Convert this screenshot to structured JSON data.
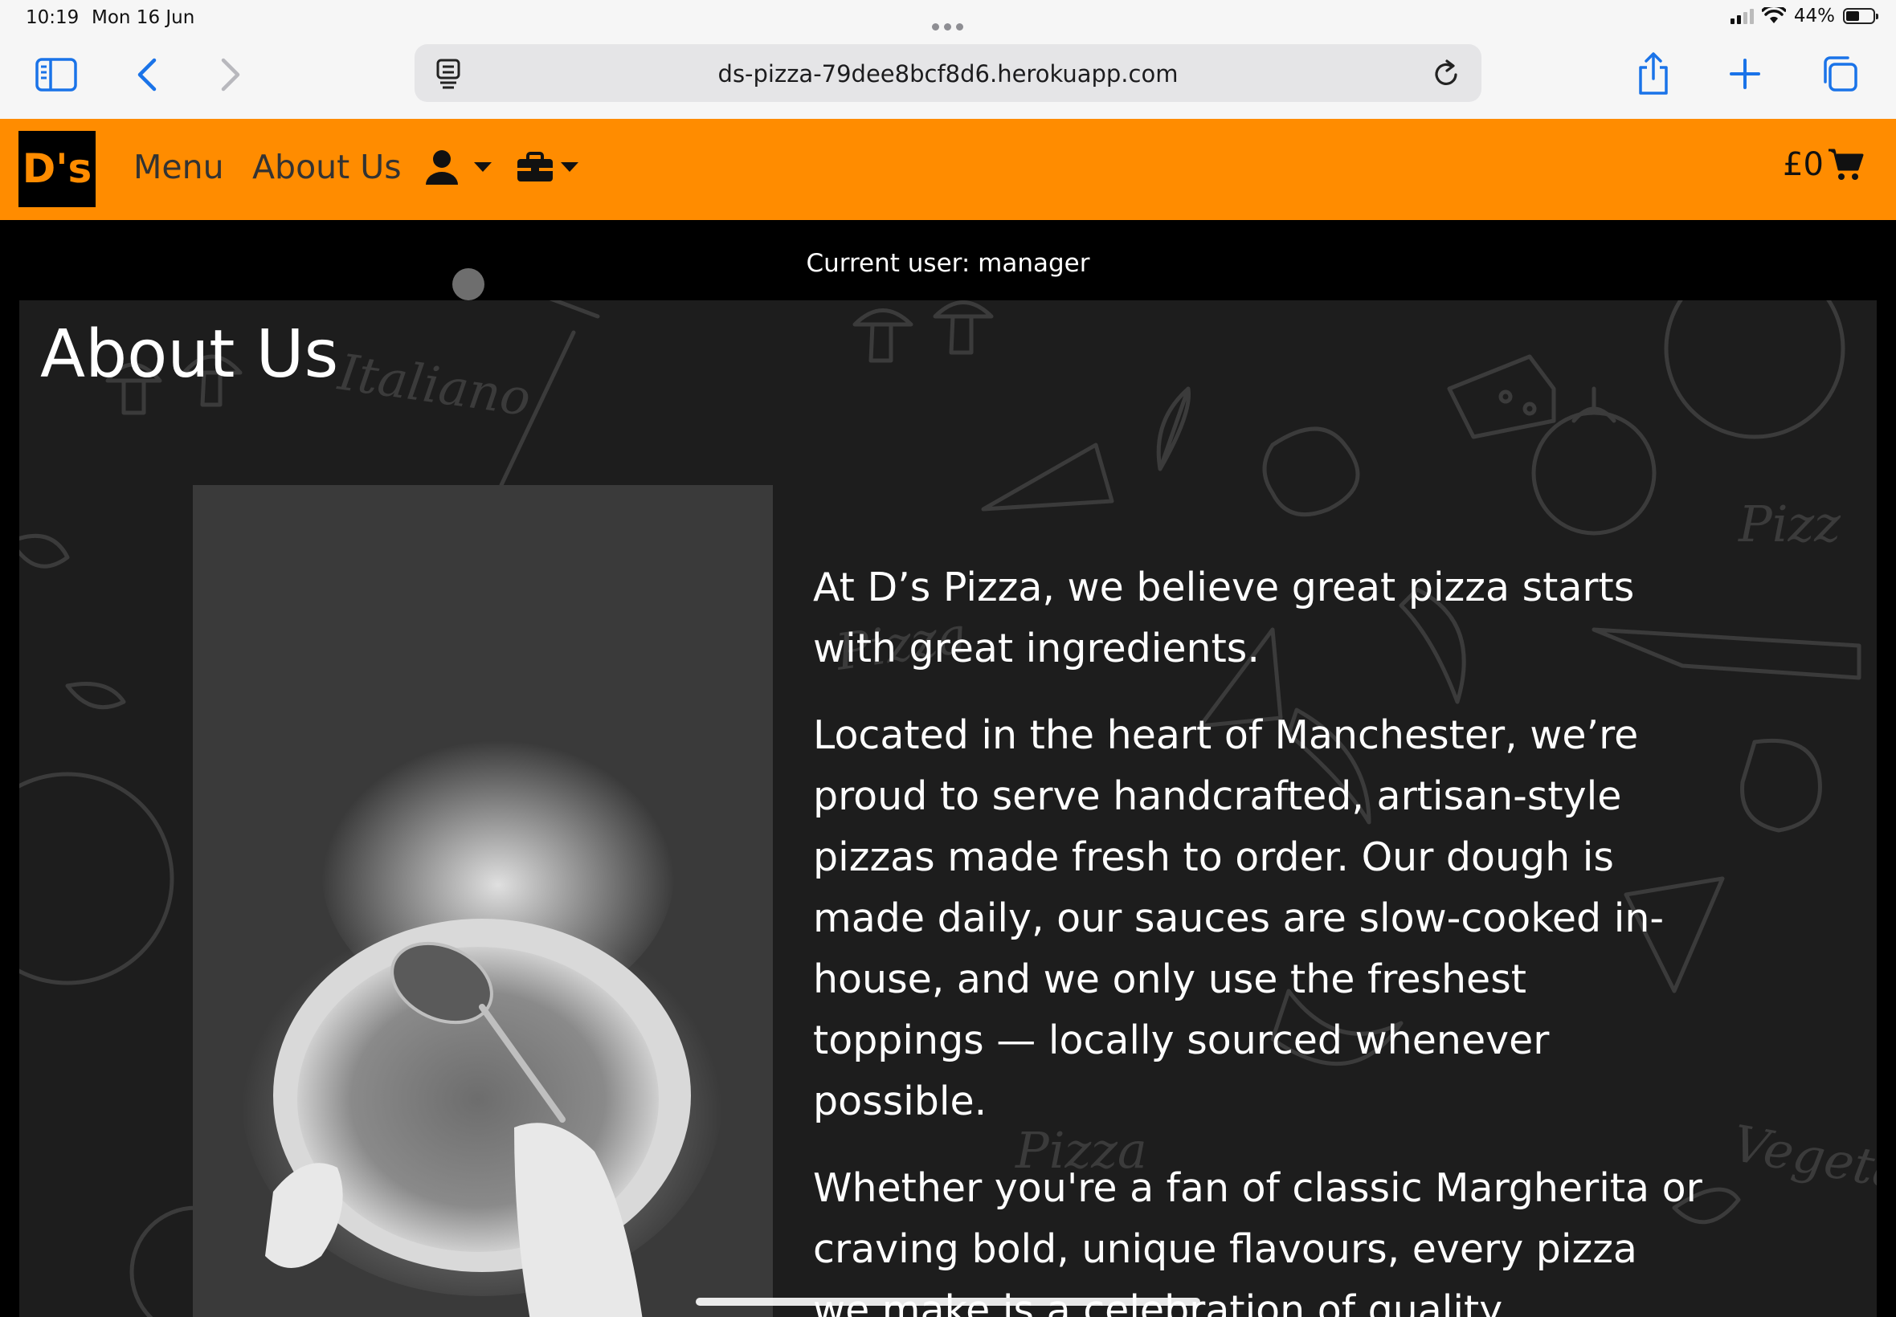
{
  "status": {
    "time": "10:19",
    "date": "Mon 16 Jun",
    "battery": "44%",
    "battery_level": 0.44
  },
  "browser": {
    "url": "ds-pizza-79dee8bcf8d6.herokuapp.com",
    "accent": "#1a73e8"
  },
  "navbar": {
    "logo": "D's",
    "links": [
      "Menu",
      "About Us"
    ],
    "cart_total": "£0",
    "color": "#ff8c00"
  },
  "session": {
    "current_user": "Current user: manager"
  },
  "about": {
    "title": "About Us",
    "paragraphs": [
      "At D’s Pizza, we believe great pizza starts with great ingredients.",
      "Located in the heart of Manchester, we’re proud to serve handcrafted, artisan-style pizzas made fresh to order. Our dough is made daily, our sauces are slow-cooked in-house, and we only use the freshest toppings — locally sourced whenever possible.",
      "Whether you're a fan of classic Margherita or craving bold, unique flavours, every pizza we make is a celebration of quality"
    ]
  }
}
